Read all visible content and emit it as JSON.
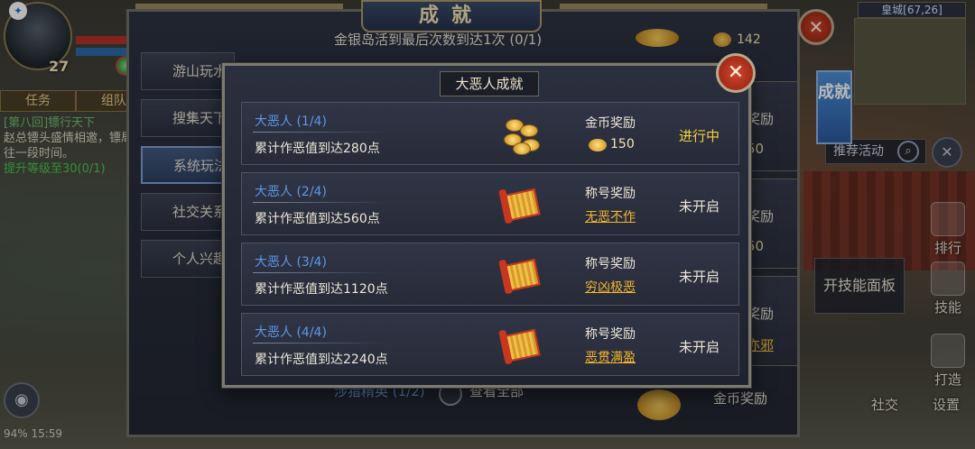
{
  "hud": {
    "level": "27",
    "tabs": [
      "任务",
      "组队"
    ],
    "quest": {
      "title": "[第八回]镖行天下",
      "desc": "赵总镖头盛情相邀，镖局往一段时间。",
      "progress": "提升等级至30(0/1)"
    },
    "status_line": "94% 15:59"
  },
  "minimap": {
    "label": "皇城[67,26]"
  },
  "side": {
    "recommend_label": "推荐活动",
    "search_icon": "search-icon",
    "close_icon": "close-icon",
    "rank_label": "排行",
    "skill_panel_label": "开技能面板",
    "skill_label": "技能",
    "forge_label": "打造",
    "social_label": "社交",
    "settings_label": "设置"
  },
  "main_panel": {
    "title": "成就",
    "side_tab": "成就",
    "nav": [
      "游山玩水",
      "搜集天下",
      "系统玩法",
      "社交关系",
      "个人兴趣"
    ],
    "active_nav_index": 2,
    "top_row_text": "金银岛活到最后次数到达1次 (0/1)",
    "top_row_value": "142",
    "right_cards": [
      {
        "label": "奖励",
        "sub": "50"
      },
      {
        "label": "奖励",
        "sub": "50"
      },
      {
        "label": "奖励",
        "sub": "亦邪"
      }
    ],
    "bottom_row_text": "涉猎精英 (1/2)",
    "bottom_view_all": "查看全部",
    "bottom_reward": "金币奖励"
  },
  "popup": {
    "title": "大恶人成就",
    "rows": [
      {
        "name": "大恶人 (1/4)",
        "desc": "累计作恶值到达280点",
        "reward_label": "金币奖励",
        "reward_kind": "coins",
        "reward_value": "150",
        "status": "进行中",
        "status_kind": "progress"
      },
      {
        "name": "大恶人 (2/4)",
        "desc": "累计作恶值到达560点",
        "reward_label": "称号奖励",
        "reward_kind": "title",
        "reward_value": "无恶不作",
        "status": "未开启",
        "status_kind": "locked"
      },
      {
        "name": "大恶人 (3/4)",
        "desc": "累计作恶值到达1120点",
        "reward_label": "称号奖励",
        "reward_kind": "title",
        "reward_value": "穷凶极恶",
        "status": "未开启",
        "status_kind": "locked"
      },
      {
        "name": "大恶人 (4/4)",
        "desc": "累计作恶值到达2240点",
        "reward_label": "称号奖励",
        "reward_kind": "title",
        "reward_value": "恶贯满盈",
        "status": "未开启",
        "status_kind": "locked"
      }
    ]
  },
  "colors": {
    "status_progress": "#f3d23f",
    "title_reward": "#f4b52e",
    "achievement_name": "#5d97e8",
    "close_button": "#d2462c"
  }
}
